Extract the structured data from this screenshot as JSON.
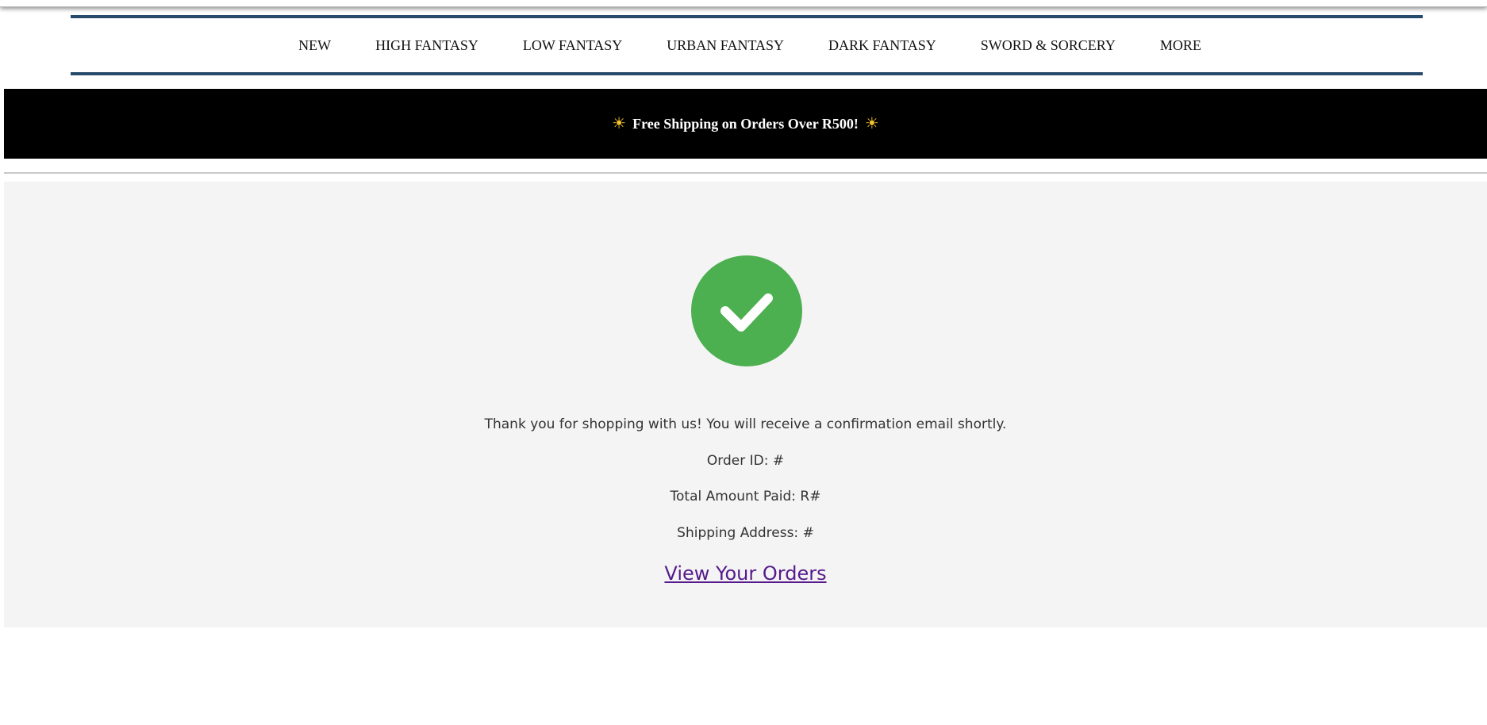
{
  "nav": {
    "items": [
      {
        "label": "NEW"
      },
      {
        "label": "HIGH FANTASY"
      },
      {
        "label": "LOW FANTASY"
      },
      {
        "label": "URBAN FANTASY"
      },
      {
        "label": "DARK FANTASY"
      },
      {
        "label": "SWORD & SORCERY"
      },
      {
        "label": "MORE"
      }
    ]
  },
  "banner": {
    "icon_left": "sun-icon",
    "icon_right": "sun-icon",
    "glyph": "☀",
    "text": "Free Shipping on Orders Over R500!",
    "background": "#000000",
    "text_color": "#ffffff"
  },
  "confirmation": {
    "icon": "check-circle-icon",
    "icon_color": "#4caf50",
    "thanks_text": "Thank you for shopping with us! You will receive a confirmation email shortly.",
    "order_id": "Order ID: #",
    "total_paid": "Total Amount Paid: R#",
    "shipping_address": "Shipping Address: #",
    "view_orders_label": "View Your Orders",
    "link_color": "#551a8b"
  },
  "theme": {
    "nav_border_color": "#264a6b",
    "panel_background": "#f4f4f4"
  }
}
